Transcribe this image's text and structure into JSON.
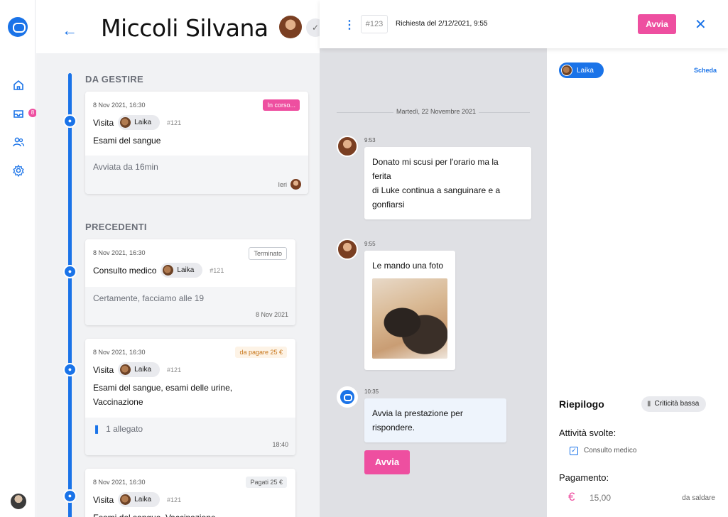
{
  "rail": {
    "icons": [
      "logo-icon",
      "home-icon",
      "inbox-icon",
      "users-icon",
      "settings-icon"
    ],
    "inbox_badge": "8"
  },
  "header": {
    "title": "Miccoli Silvana"
  },
  "timeline": {
    "section_active": "DA GESTIRE",
    "section_past": "PRECEDENTI",
    "cards": [
      {
        "date": "8 Nov 2021, 16:30",
        "tag": "In corso...",
        "type": "Visita",
        "pet": "Laika",
        "code": "#121",
        "desc": "Esami del sangue",
        "foot_text": "Avviata da 16min",
        "foot_right": "Ieri"
      },
      {
        "date": "8 Nov 2021, 16:30",
        "tag": "Terminato",
        "type": "Consulto medico",
        "pet": "Laika",
        "code": "#121",
        "foot_text": "Certamente, facciamo alle 19",
        "foot_right": "8 Nov 2021"
      },
      {
        "date": "8 Nov 2021, 16:30",
        "tag": "da pagare 25 €",
        "type": "Visita",
        "pet": "Laika",
        "code": "#121",
        "desc_line1": "Esami del sangue, esami delle urine,",
        "desc_line2": "Vaccinazione",
        "foot_text": "1 allegato",
        "foot_right": "18:40"
      },
      {
        "date": "8 Nov 2021, 16:30",
        "tag": "Pagati 25 €",
        "type": "Visita",
        "pet": "Laika",
        "code": "#121",
        "desc": "Esami del sangue, Vaccinazione"
      }
    ]
  },
  "panel": {
    "ticket": "#123",
    "request": "Richiesta del 2/12/2021, 9:55",
    "start_label": "Avvia"
  },
  "chat": {
    "day": "Martedì, 22 Novembre 2021",
    "messages": [
      {
        "time": "9:53",
        "lines": [
          "Donato mi scusi per l'orario ma la",
          "ferita",
          "di Luke continua a sanguinare e a",
          "gonfiarsi"
        ]
      },
      {
        "time": "9:55",
        "text": "Le mando una foto"
      },
      {
        "time": "10:35",
        "lines": [
          "Avvia la prestazione per",
          "rispondere."
        ]
      }
    ],
    "start_label": "Avvia"
  },
  "sidebar": {
    "pet": "Laika",
    "scheda": "Scheda",
    "summary_title": "Riepilogo",
    "criticality": "Criticità bassa",
    "activities_title": "Attività svolte:",
    "activity": "Consulto medico",
    "payment_title": "Pagamento:",
    "amount": "15,00",
    "due": "da saldare"
  },
  "colors": {
    "accent": "#1a73e8",
    "pink": "#ee4fa0"
  }
}
